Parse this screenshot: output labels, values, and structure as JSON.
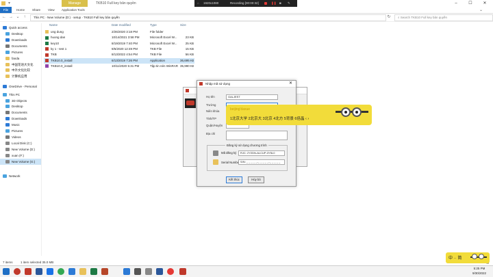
{
  "titlebar": {
    "manage_tab": "Manage",
    "title": "TKB10 Full key bản quyền",
    "recorder_resolution": "1920x1080",
    "recorder_status": "Recording [00:00:32]"
  },
  "ribbon": {
    "tabs": [
      "File",
      "Home",
      "Share",
      "View",
      "Application Tools"
    ]
  },
  "address": {
    "path": [
      "This PC",
      "New Volume (D:)",
      "setup",
      "TKB10 Full key bản quyền"
    ],
    "search_placeholder": "Search TKB10 Full key bản quyền"
  },
  "sidebar": {
    "items": [
      {
        "label": "Quick access",
        "icon": "star-icon",
        "color": "#2c7ad6"
      },
      {
        "label": "Desktop",
        "icon": "desktop-icon",
        "color": "#4aa3df"
      },
      {
        "label": "Downloads",
        "icon": "download-icon",
        "color": "#2c7ad6"
      },
      {
        "label": "Documents",
        "icon": "document-icon",
        "color": "#777"
      },
      {
        "label": "Pictures",
        "icon": "picture-icon",
        "color": "#4aa3df"
      },
      {
        "label": "fanda",
        "icon": "folder-icon",
        "color": "#e8c15a"
      },
      {
        "label": "中国花语大文化",
        "icon": "folder-icon",
        "color": "#e8c15a"
      },
      {
        "label": "中外文化比较",
        "icon": "folder-icon",
        "color": "#e8c15a"
      },
      {
        "label": "计算机应用",
        "icon": "folder-icon",
        "color": "#e8c15a"
      },
      {
        "label": "OneDrive - Personal",
        "icon": "cloud-icon",
        "color": "#2c7ad6"
      },
      {
        "label": "This PC",
        "icon": "pc-icon",
        "color": "#4aa3df"
      },
      {
        "label": "3D Objects",
        "icon": "cube-icon",
        "color": "#4aa3df"
      },
      {
        "label": "Desktop",
        "icon": "desktop-icon",
        "color": "#4aa3df"
      },
      {
        "label": "Documents",
        "icon": "document-icon",
        "color": "#777"
      },
      {
        "label": "Downloads",
        "icon": "download-icon",
        "color": "#2c7ad6"
      },
      {
        "label": "Music",
        "icon": "music-icon",
        "color": "#2c7ad6"
      },
      {
        "label": "Pictures",
        "icon": "picture-icon",
        "color": "#4aa3df"
      },
      {
        "label": "Videos",
        "icon": "video-icon",
        "color": "#777"
      },
      {
        "label": "Local Disk (C:)",
        "icon": "drive-icon",
        "color": "#888"
      },
      {
        "label": "New Volume (D:)",
        "icon": "drive-icon",
        "color": "#888"
      },
      {
        "label": "xuan (F:)",
        "icon": "drive-icon",
        "color": "#888"
      },
      {
        "label": "New Volume (G:)",
        "icon": "drive-icon",
        "color": "#888",
        "selected": true
      },
      {
        "label": "Network",
        "icon": "network-icon",
        "color": "#4aa3df"
      }
    ]
  },
  "filelist": {
    "columns": [
      "Name",
      "Date modified",
      "Type",
      "Size"
    ],
    "rows": [
      {
        "name": "ung dung",
        "date": "2/26/2020 3:18 PM",
        "type": "File folder",
        "size": "",
        "color": "#e8c15a"
      },
      {
        "name": "huong dan",
        "date": "10/14/2021 3:58 PM",
        "type": "Microsoft Excel W...",
        "size": "23 KB",
        "color": "#1d7a45"
      },
      {
        "name": "key10",
        "date": "8/19/2019 7:40 PM",
        "type": "Microsoft Excel W...",
        "size": "25 KB",
        "color": "#1d7a45"
      },
      {
        "name": "ky 1 - test 1",
        "date": "9/6/2020 12:49 PM",
        "type": "TKB File",
        "size": "15 KB",
        "color": "#c0392b"
      },
      {
        "name": "TKB",
        "date": "8/13/2022 4:54 PM",
        "type": "TKB File",
        "size": "56 KB",
        "color": "#c0392b"
      },
      {
        "name": "TKB10.0_install",
        "date": "6/13/2019 7:26 PM",
        "type": "Application",
        "size": "36,695 KB",
        "color": "#c0392b",
        "selected": true
      },
      {
        "name": "TKB10.0_install",
        "date": "10/11/2020 5:31 PM",
        "type": "Tập tin nén WinRAR",
        "size": "35,990 KB",
        "color": "#8e44ad"
      }
    ]
  },
  "status": {
    "count": "7 items",
    "selected": "1 item selected  35.0 MB"
  },
  "clock": {
    "time": "5:25 PM",
    "date": "9/30/2022"
  },
  "dialog": {
    "title": "Nhập mã sử dụng",
    "fields": [
      {
        "label": "Họ tên",
        "value": "GALJEST"
      },
      {
        "label": "Trường",
        "value": ""
      },
      {
        "label": "Niên khóa",
        "value": ""
      },
      {
        "label": "Tỉnh/TP",
        "value": ""
      },
      {
        "label": "Quận/Huyện",
        "value": ""
      },
      {
        "label": "Địa chỉ",
        "value": ""
      }
    ],
    "register_title": "Đăng ký sử dụng chương trình",
    "regcode_label": "Mã đăng ký",
    "regcode_value": "RJC: 2Y2DN-ALCUP-3Y5L0",
    "serial_label": "Serial Number",
    "serial_value": "S/N: _ _ _ _ _-_ _ _ _ _-_ _ _ _ _",
    "ok_label": "Kết thúc",
    "cancel_label": "Hủy bỏ"
  },
  "ime": {
    "pinyin": "beijing'daxue",
    "candidates": "1北京大学  2北京大  3北京  4北方  5背景  6倍晶  ‹ ›",
    "bar_label": "中 ·· 简"
  }
}
